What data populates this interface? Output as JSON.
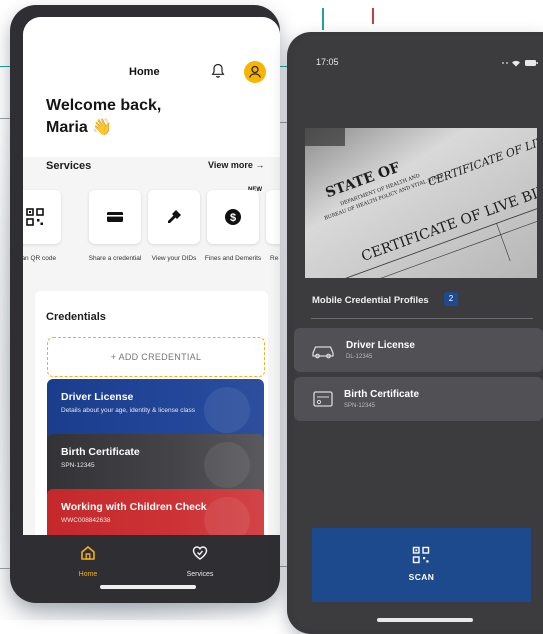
{
  "left_app": {
    "header": {
      "title": "Home"
    },
    "welcome": {
      "line1": "Welcome back,",
      "line2": "Maria 👋"
    },
    "services": {
      "label": "Services",
      "view_more": "View more →",
      "new_badge": "NEW",
      "items": [
        {
          "label": "Scan QR code",
          "icon": "qr-icon"
        },
        {
          "label": "Share a credential",
          "icon": "card-icon"
        },
        {
          "label": "View your DIDs",
          "icon": "key-icon"
        },
        {
          "label": "Fines and Demerits",
          "icon": "dollar-icon"
        },
        {
          "label": "Re",
          "icon": ""
        }
      ]
    },
    "credentials": {
      "label": "Credentials",
      "add_label": "+ ADD CREDENTIAL",
      "cards": [
        {
          "title": "Driver License",
          "subtitle": "Details about your age, identity & license class",
          "color": "#1a3d8c"
        },
        {
          "title": "Birth Certificate",
          "subtitle": "SPN-12345",
          "color": "#3a3a3e"
        },
        {
          "title": "Working with Children Check",
          "subtitle": "WWC008842638",
          "color": "#c4282b"
        }
      ]
    },
    "tabbar": {
      "tabs": [
        {
          "label": "Home",
          "icon": "home-icon",
          "active": true
        },
        {
          "label": "Services",
          "icon": "heart-icon",
          "active": false
        }
      ]
    },
    "colors": {
      "accent": "#f7b500",
      "active_tab": "#f2b01e"
    }
  },
  "right_app": {
    "status_bar": {
      "time": "17:05"
    },
    "certificate_image": {
      "line1": "STATE OF",
      "line2": "DEPARTMENT OF HEALTH AND",
      "line3": "BUREAU OF HEALTH POLICY AND VITAL STATS",
      "line4": "CERTIFICATE OF LIVE BIRTH",
      "line5": "CERTIFICATE OF LIVE BIRTH"
    },
    "profiles": {
      "label": "Mobile Credential Profiles",
      "count": "2",
      "items": [
        {
          "title": "Driver License",
          "subtitle": "DL-12345",
          "icon": "car-icon"
        },
        {
          "title": "Birth Certificate",
          "subtitle": "SPN-12345",
          "icon": "certificate-icon"
        }
      ]
    },
    "scan_button": {
      "label": "SCAN"
    },
    "colors": {
      "scan": "#1d4a8c",
      "badge": "#1e4b8f"
    }
  }
}
